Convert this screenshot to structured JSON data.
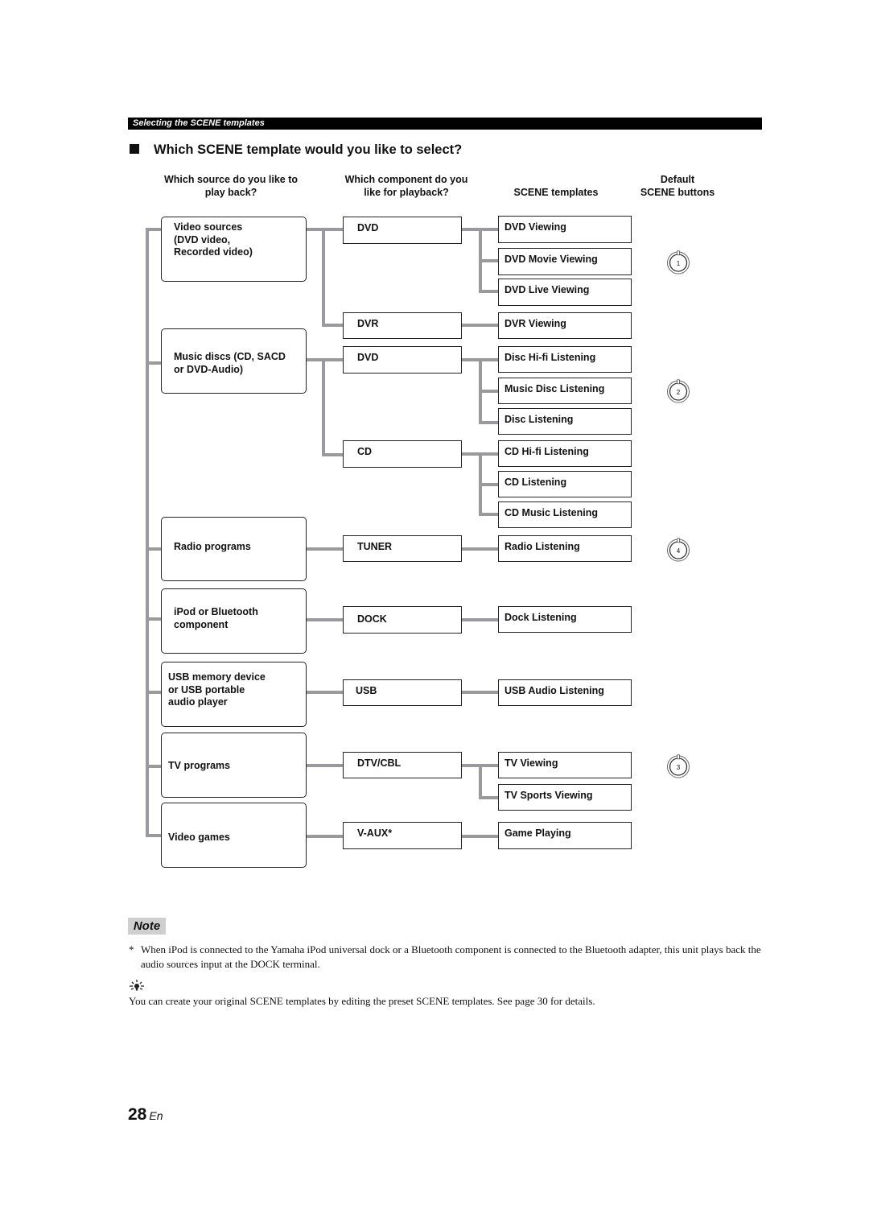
{
  "section_header": "Selecting the SCENE templates",
  "heading": "Which SCENE template would you like to select?",
  "columns": {
    "source": [
      "Which source do you like to",
      "play back?"
    ],
    "component": [
      "Which component do you",
      "like for playback?"
    ],
    "templates": "SCENE templates",
    "buttons": [
      "Default",
      "SCENE buttons"
    ]
  },
  "sources": [
    {
      "label": "Video sources\n(DVD video,\nRecorded video)"
    },
    {
      "label": "Music discs (CD, SACD\nor DVD-Audio)"
    },
    {
      "label": "Radio programs"
    },
    {
      "label": "iPod or Bluetooth\ncomponent"
    },
    {
      "label": "USB memory device\nor USB portable\naudio player"
    },
    {
      "label": "TV programs"
    },
    {
      "label": "Video games"
    }
  ],
  "components": [
    "DVD",
    "DVR",
    "DVD",
    "CD",
    "TUNER",
    "DOCK",
    "USB",
    "DTV/CBL",
    "V-AUX*"
  ],
  "templates": [
    "DVD Viewing",
    "DVD Movie Viewing",
    "DVD Live Viewing",
    "DVR Viewing",
    "Disc Hi-fi Listening",
    "Music Disc Listening",
    "Disc Listening",
    "CD Hi-fi Listening",
    "CD Listening",
    "CD Music Listening",
    "Radio Listening",
    "Dock Listening",
    "USB Audio Listening",
    "TV Viewing",
    "TV Sports Viewing",
    "Game Playing"
  ],
  "scene_buttons": [
    {
      "number": "1",
      "icon": "scene-knob-icon"
    },
    {
      "number": "2",
      "icon": "scene-knob-icon"
    },
    {
      "number": "4",
      "icon": "scene-knob-icon"
    },
    {
      "number": "3",
      "icon": "scene-knob-icon"
    }
  ],
  "note": {
    "label": "Note",
    "footnote_mark": "*",
    "footnote": "When iPod is connected to the Yamaha iPod universal dock or a Bluetooth component is connected to the Bluetooth adapter, this unit plays back the audio sources input at the DOCK terminal.",
    "tip_icon": "lightbulb-tip-icon",
    "tip": "You can create your original SCENE templates by editing the preset SCENE templates. See page 30 for details."
  },
  "page": {
    "number": "28",
    "lang": "En"
  }
}
